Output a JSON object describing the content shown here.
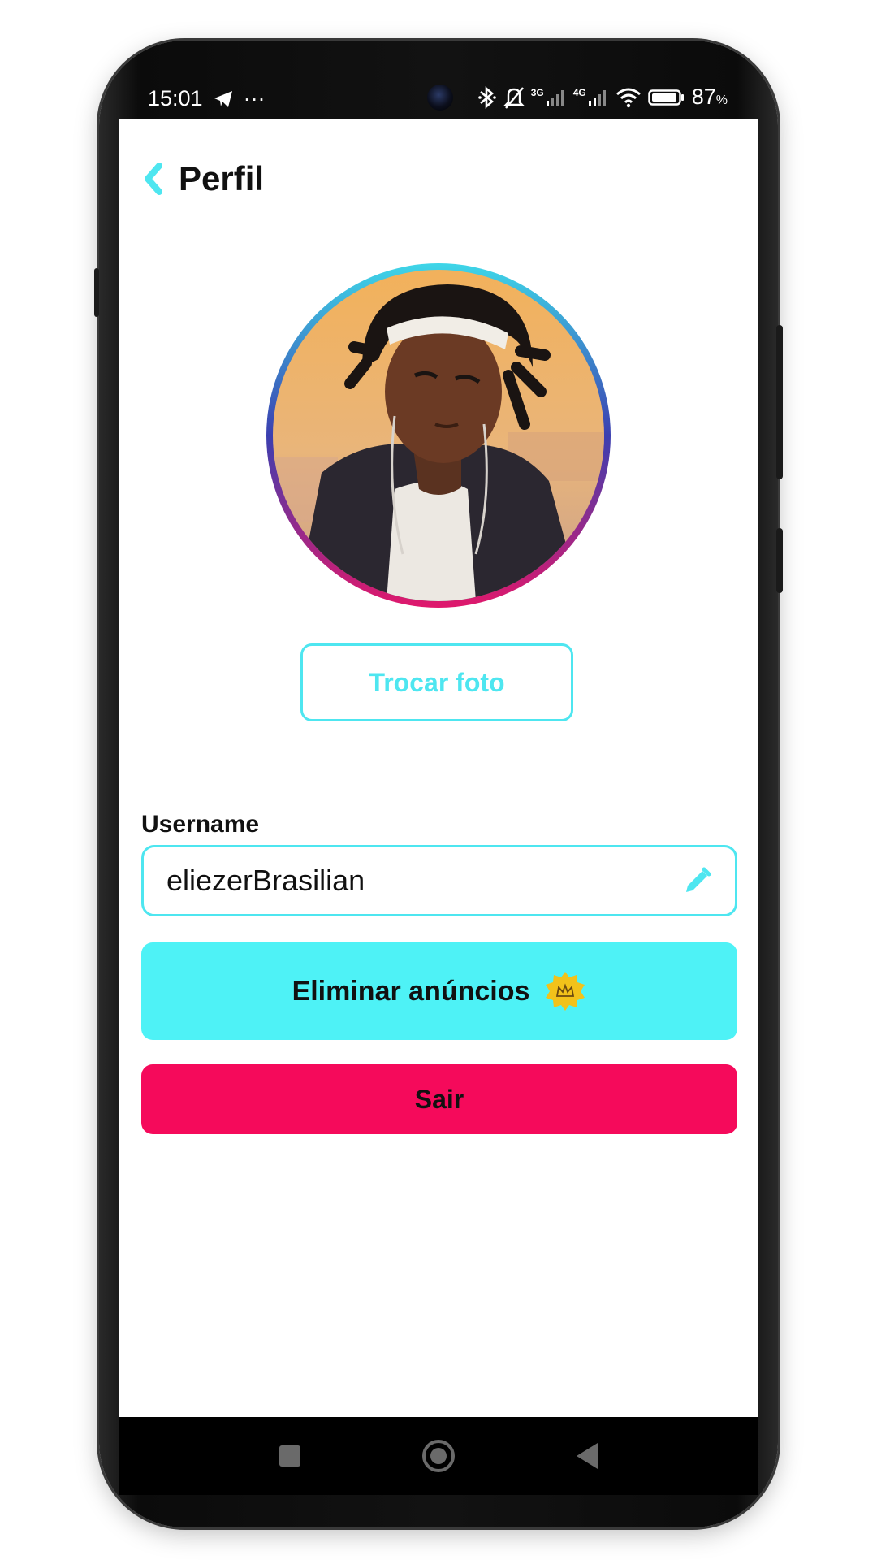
{
  "status_bar": {
    "time": "15:01",
    "more": "···",
    "net_3g": "3G",
    "net_4g": "4G",
    "battery": "87",
    "battery_unit": "%"
  },
  "header": {
    "title": "Perfil"
  },
  "profile": {
    "change_photo_label": "Trocar foto",
    "username_label": "Username",
    "username_value": "eliezerBrasilian",
    "remove_ads_label": "Eliminar anúncios",
    "logout_label": "Sair"
  },
  "colors": {
    "accent": "#4ee6f0",
    "remove_ads_bg": "#4ef2f6",
    "logout_bg": "#f50a5b",
    "badge": "#f2c21a"
  },
  "icons": {
    "back": "back-chevron-icon",
    "edit": "pencil-icon",
    "badge": "crown-badge-icon",
    "nav": [
      "recent-apps-icon",
      "home-icon",
      "back-nav-icon"
    ]
  }
}
